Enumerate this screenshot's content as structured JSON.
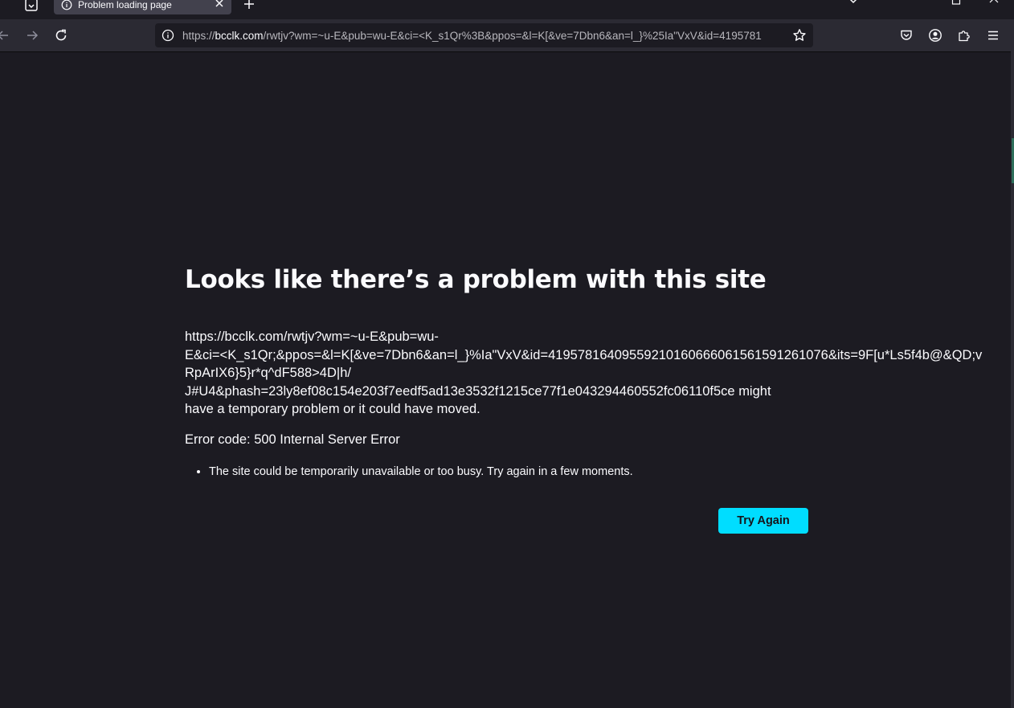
{
  "tabs": [
    {
      "title": "Problem loading page"
    }
  ],
  "toolbar": {
    "url_domain": "bcclk.com",
    "url_prefix": "https://",
    "url_rest": "/rwtjv?wm=~u-E&pub=wu-E&ci=<K_s1Qr%3B&ppos=&l=K[&ve=7Dbn6&an=l_}%25Ia\"VxV&id=4195781"
  },
  "icons": {
    "tab_list": "tab-list-icon",
    "tab_info": "info-icon",
    "tab_close": "close-icon",
    "new_tab": "plus-icon",
    "back": "back-arrow-icon",
    "forward": "forward-arrow-icon",
    "reload": "reload-icon",
    "bookmark": "star-icon",
    "pocket": "pocket-icon",
    "account": "account-icon",
    "extensions": "extensions-icon",
    "menu": "hamburger-menu-icon"
  },
  "error": {
    "title": "Looks like there’s a problem with this site",
    "description": "https://bcclk.com/rwtjv?wm=~u-E&pub=wu-\nE&ci=<K_s1Qr;&ppos=&l=K[&ve=7Dbn6&an=l_}%Ia\"VxV&id=41957816409559210160666061561591261076&its=9F[u*Ls5f4b@&QD;v\nRpArIX6}5}r*q^dF588>4D|h/\nJ#U4&phash=23ly8ef08c154e203f7eedf5ad13e3532f1215ce77f1e043294460552fc06110f5ce might\nhave a temporary problem or it could have moved.",
    "code": "Error code: 500 Internal Server Error",
    "suggestions": [
      "The site could be temporarily unavailable or too busy. Try again in a few moments."
    ],
    "button_label": "Try Again"
  },
  "colors": {
    "background": "#1c1b22",
    "toolbar": "#2b2a33",
    "text": "#fbfbfe",
    "accent_button": "#00ddff"
  }
}
